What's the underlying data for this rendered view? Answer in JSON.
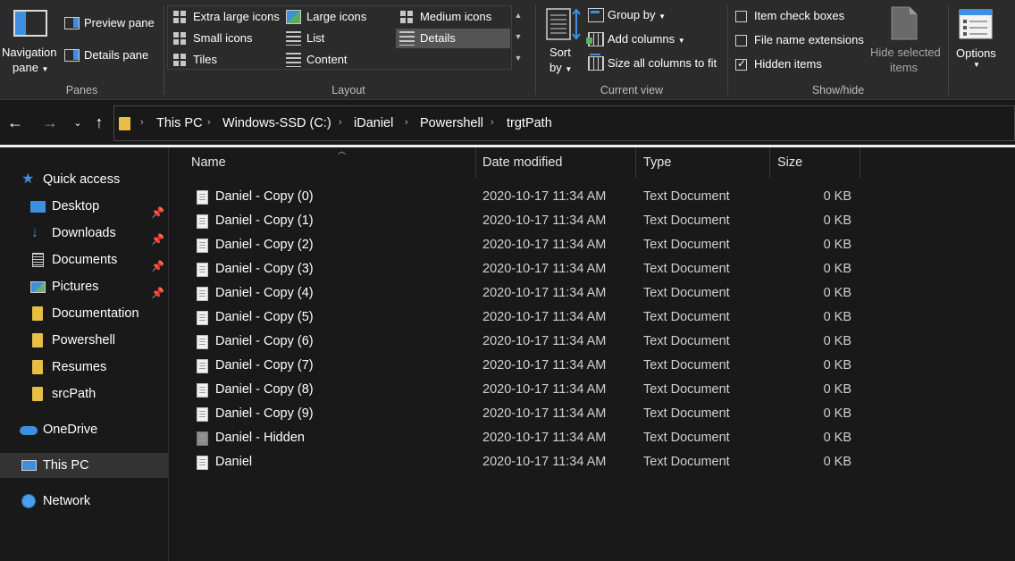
{
  "ribbon": {
    "panes": {
      "label": "Panes",
      "navigation_pane": [
        "Navigation",
        "pane"
      ],
      "preview_pane": "Preview pane",
      "details_pane": "Details pane"
    },
    "layout": {
      "label": "Layout",
      "options": [
        {
          "label": "Extra large icons",
          "icon": "extra-large-icons-icon"
        },
        {
          "label": "Large icons",
          "icon": "large-icons-icon"
        },
        {
          "label": "Medium icons",
          "icon": "medium-icons-icon"
        },
        {
          "label": "Small icons",
          "icon": "small-icons-icon"
        },
        {
          "label": "List",
          "icon": "list-icon"
        },
        {
          "label": "Details",
          "icon": "details-icon",
          "selected": true
        },
        {
          "label": "Tiles",
          "icon": "tiles-icon"
        },
        {
          "label": "Content",
          "icon": "content-icon"
        }
      ]
    },
    "current_view": {
      "label": "Current view",
      "sort_by": [
        "Sort",
        "by"
      ],
      "group_by": "Group by",
      "add_columns": "Add columns",
      "size_all_columns": "Size all columns to fit"
    },
    "show_hide": {
      "label": "Show/hide",
      "item_check_boxes": {
        "label": "Item check boxes",
        "checked": false
      },
      "file_name_extensions": {
        "label": "File name extensions",
        "checked": false
      },
      "hidden_items": {
        "label": "Hidden items",
        "checked": true
      },
      "hide_selected": [
        "Hide selected",
        "items"
      ]
    },
    "options": "Options"
  },
  "address": {
    "breadcrumbs": [
      "This PC",
      "Windows-SSD (C:)",
      "iDaniel",
      "Powershell",
      "trgtPath"
    ]
  },
  "sidebar": {
    "quick_access": "Quick access",
    "quick_items": [
      {
        "label": "Desktop",
        "pinned": true
      },
      {
        "label": "Downloads",
        "pinned": true
      },
      {
        "label": "Documents",
        "pinned": true
      },
      {
        "label": "Pictures",
        "pinned": true
      },
      {
        "label": "Documentation",
        "pinned": false
      },
      {
        "label": "Powershell",
        "pinned": false
      },
      {
        "label": "Resumes",
        "pinned": false
      },
      {
        "label": "srcPath",
        "pinned": false
      }
    ],
    "onedrive": "OneDrive",
    "this_pc": "This PC",
    "network": "Network"
  },
  "files": {
    "columns": [
      "Name",
      "Date modified",
      "Type",
      "Size"
    ],
    "rows": [
      {
        "name": "Daniel - Copy (0)",
        "date": "2020-10-17 11:34 AM",
        "type": "Text Document",
        "size": "0 KB",
        "hidden": false
      },
      {
        "name": "Daniel - Copy (1)",
        "date": "2020-10-17 11:34 AM",
        "type": "Text Document",
        "size": "0 KB",
        "hidden": false
      },
      {
        "name": "Daniel - Copy (2)",
        "date": "2020-10-17 11:34 AM",
        "type": "Text Document",
        "size": "0 KB",
        "hidden": false
      },
      {
        "name": "Daniel - Copy (3)",
        "date": "2020-10-17 11:34 AM",
        "type": "Text Document",
        "size": "0 KB",
        "hidden": false
      },
      {
        "name": "Daniel - Copy (4)",
        "date": "2020-10-17 11:34 AM",
        "type": "Text Document",
        "size": "0 KB",
        "hidden": false
      },
      {
        "name": "Daniel - Copy (5)",
        "date": "2020-10-17 11:34 AM",
        "type": "Text Document",
        "size": "0 KB",
        "hidden": false
      },
      {
        "name": "Daniel - Copy (6)",
        "date": "2020-10-17 11:34 AM",
        "type": "Text Document",
        "size": "0 KB",
        "hidden": false
      },
      {
        "name": "Daniel - Copy (7)",
        "date": "2020-10-17 11:34 AM",
        "type": "Text Document",
        "size": "0 KB",
        "hidden": false
      },
      {
        "name": "Daniel - Copy (8)",
        "date": "2020-10-17 11:34 AM",
        "type": "Text Document",
        "size": "0 KB",
        "hidden": false
      },
      {
        "name": "Daniel - Copy (9)",
        "date": "2020-10-17 11:34 AM",
        "type": "Text Document",
        "size": "0 KB",
        "hidden": false
      },
      {
        "name": "Daniel - Hidden",
        "date": "2020-10-17 11:34 AM",
        "type": "Text Document",
        "size": "0 KB",
        "hidden": true
      },
      {
        "name": "Daniel",
        "date": "2020-10-17 11:34 AM",
        "type": "Text Document",
        "size": "0 KB",
        "hidden": false
      }
    ]
  },
  "colors": {
    "background": "#191919",
    "ribbon": "#2b2b2b",
    "accent": "#3e8fe0",
    "folder": "#e8bf45",
    "selected": "#545454"
  }
}
